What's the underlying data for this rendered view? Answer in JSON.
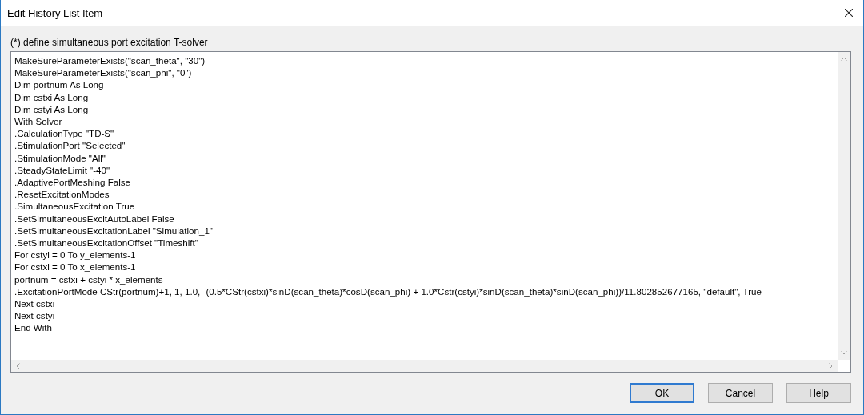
{
  "window": {
    "title": "Edit History List Item"
  },
  "caption": "(*) define simultaneous port excitation T-solver",
  "code_lines": [
    "MakeSureParameterExists(\"scan_theta\", \"30\")",
    "MakeSureParameterExists(\"scan_phi\", \"0\")",
    "Dim portnum As Long",
    "Dim cstxi As Long",
    "Dim cstyi As Long",
    "With Solver",
    ".CalculationType \"TD-S\"",
    ".StimulationPort \"Selected\"",
    ".StimulationMode \"All\"",
    ".SteadyStateLimit \"-40\"",
    ".AdaptivePortMeshing False",
    ".ResetExcitationModes",
    ".SimultaneousExcitation True",
    ".SetSimultaneousExcitAutoLabel False",
    ".SetSimultaneousExcitationLabel \"Simulation_1\"",
    ".SetSimultaneousExcitationOffset \"Timeshift\"",
    "For cstyi = 0 To y_elements-1",
    "For cstxi = 0 To x_elements-1",
    "portnum = cstxi + cstyi * x_elements",
    ".ExcitationPortMode CStr(portnum)+1, 1, 1.0, -(0.5*CStr(cstxi)*sinD(scan_theta)*cosD(scan_phi) + 1.0*Cstr(cstyi)*sinD(scan_theta)*sinD(scan_phi))/11.802852677165, \"default\", True",
    "Next cstxi",
    "Next cstyi",
    "End With"
  ],
  "buttons": [
    {
      "label": "OK",
      "selected": true
    },
    {
      "label": "Cancel",
      "selected": false
    },
    {
      "label": "Help",
      "selected": false
    }
  ]
}
